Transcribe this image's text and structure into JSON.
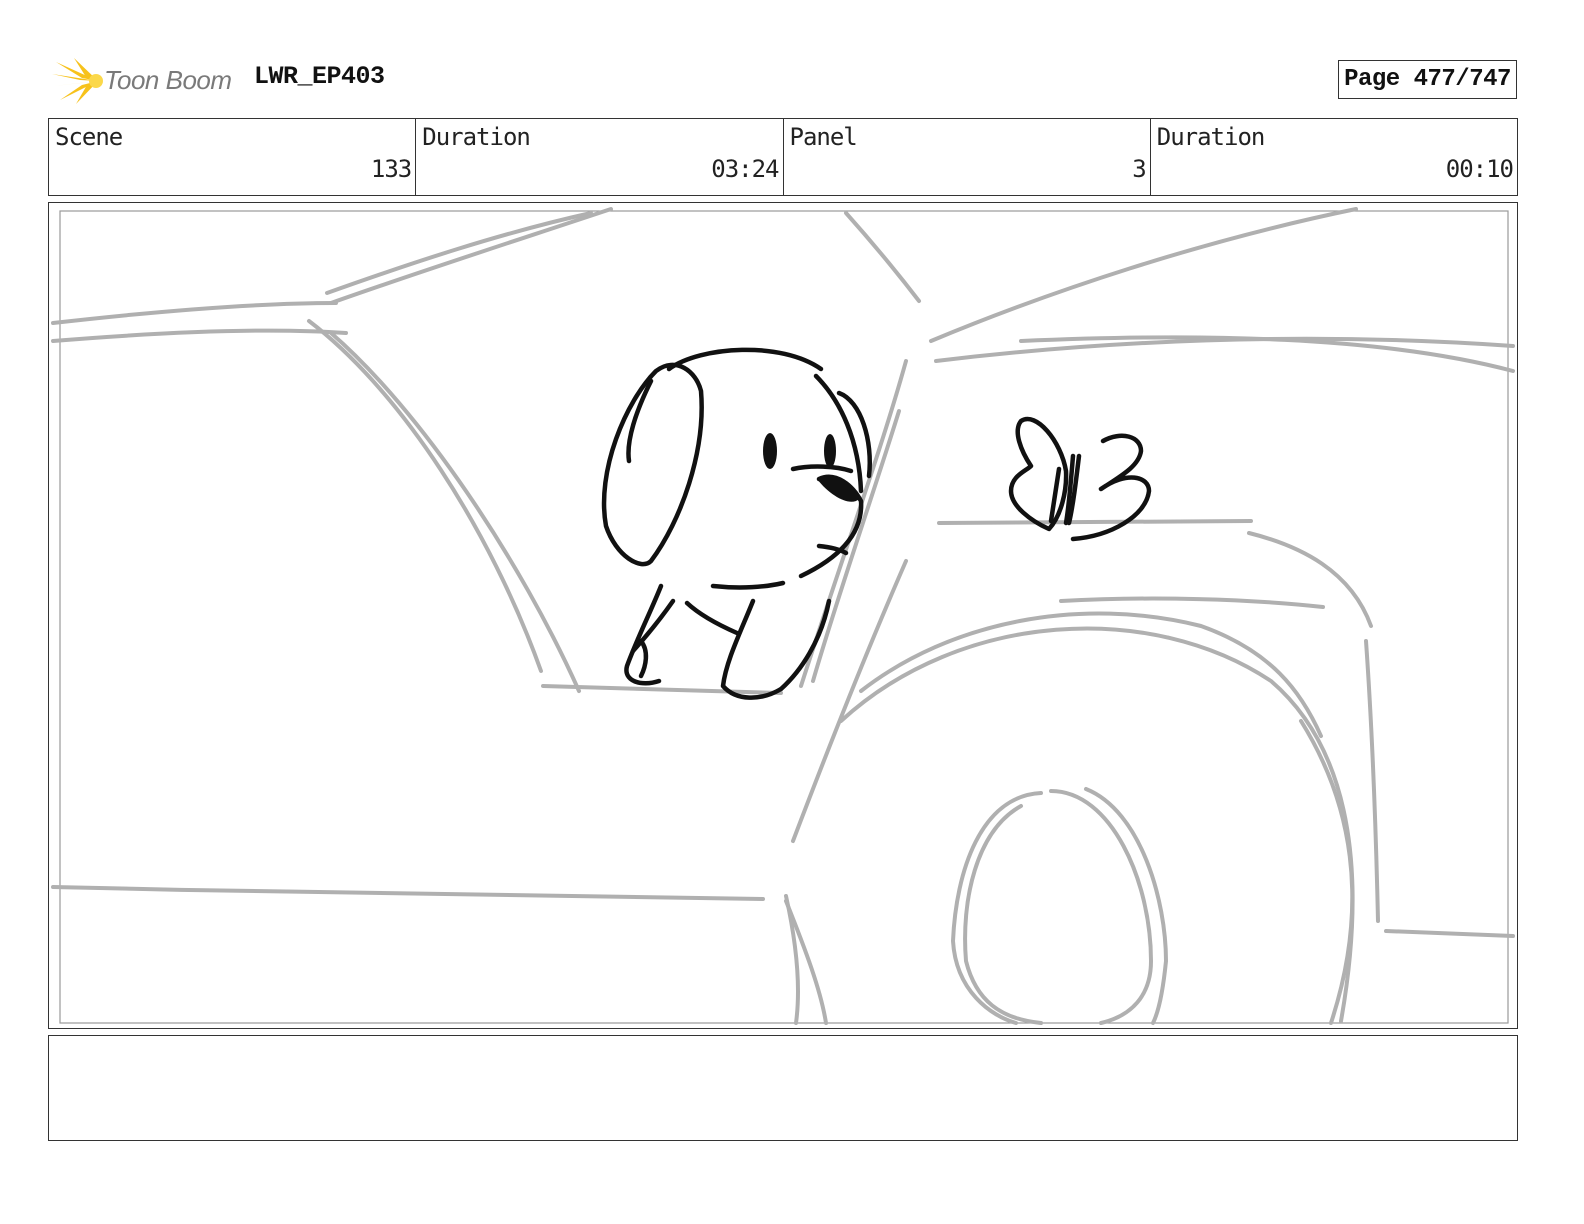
{
  "header": {
    "logo_text": "Toon Boom",
    "project": "LWR_EP403",
    "page_label": "Page 477/747"
  },
  "info": [
    {
      "label": "Scene",
      "value": "133"
    },
    {
      "label": "Duration",
      "value": "03:24"
    },
    {
      "label": "Panel",
      "value": "3"
    },
    {
      "label": "Duration",
      "value": "00:10"
    }
  ],
  "panel": {
    "description": ""
  },
  "colors": {
    "sketch_gray": "#b0b0b0",
    "ink_black": "#111111",
    "logo_yellow": "#f7c21b"
  }
}
